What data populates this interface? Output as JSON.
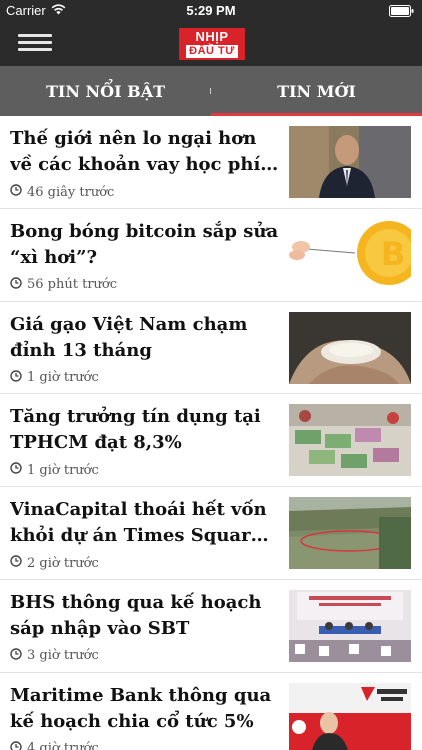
{
  "status": {
    "carrier": "Carrier",
    "time": "5:29 PM",
    "wifi_icon": "wifi-icon",
    "battery_icon": "battery-icon"
  },
  "app_bar": {
    "menu_icon": "hamburger-menu-icon",
    "logo_line1": "NHỊP CẦU",
    "logo_line2": "ĐẦU TƯ",
    "background": "#2b2b2b",
    "logo_color": "#d9232a"
  },
  "tabs": [
    {
      "label": "TIN NỔI BẬT",
      "active": false
    },
    {
      "label": "TIN MỚI",
      "active": true
    }
  ],
  "accent": "#e0383e",
  "articles": [
    {
      "title": "Thế giới nên lo ngại hơn về các khoản vay học phí tại Mỹ",
      "time": "46 giây trước",
      "image": "man-in-suit-photo"
    },
    {
      "title": "Bong bóng bitcoin sắp sửa “xì hơi”?",
      "time": "56 phút trước",
      "image": "bitcoin-balloon-photo"
    },
    {
      "title": "Giá gạo Việt Nam chạm đỉnh 13 tháng",
      "time": "1 giờ trước",
      "image": "rice-in-hands-photo"
    },
    {
      "title": "Tăng trưởng tín dụng tại TPHCM đạt 8,3%",
      "time": "1 giờ trước",
      "image": "bank-cash-counting-photo"
    },
    {
      "title": "VinaCapital thoái hết vốn khỏi dự án Times Square Hà Nội",
      "time": "2 giờ trước",
      "image": "aerial-land-photo"
    },
    {
      "title": "BHS thông qua kế hoạch sáp nhập vào SBT",
      "time": "3 giờ trước",
      "image": "shareholder-meeting-photo"
    },
    {
      "title": "Maritime Bank thông qua kế hoạch chia cổ tức 5%",
      "time": "4 giờ trước",
      "image": "maritime-bank-photo"
    }
  ]
}
